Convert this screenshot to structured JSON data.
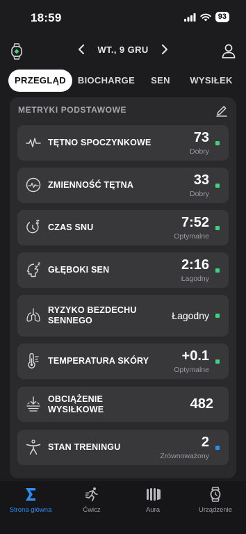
{
  "status_bar": {
    "time": "18:59",
    "battery": "93"
  },
  "header": {
    "date_label": "WT., 9 GRU"
  },
  "tabs": [
    {
      "label": "PRZEGLĄD",
      "active": true
    },
    {
      "label": "BIOCHARGE",
      "active": false
    },
    {
      "label": "SEN",
      "active": false
    },
    {
      "label": "WYSIŁEK",
      "active": false
    }
  ],
  "section": {
    "title": "METRYKI PODSTAWOWE"
  },
  "metrics": [
    {
      "label": "TĘTNO SPOCZYNKOWE",
      "value": "73",
      "sub": "Dobry",
      "status_color": "#3dd37a",
      "icon": "heart-rate-icon"
    },
    {
      "label": "ZMIENNOŚĆ TĘTNA",
      "value": "33",
      "sub": "Dobry",
      "status_color": "#3dd37a",
      "icon": "hrv-icon"
    },
    {
      "label": "CZAS SNU",
      "value": "7:52",
      "sub": "Optymalne",
      "status_color": "#3dd37a",
      "icon": "sleep-time-icon"
    },
    {
      "label": "GŁĘBOKI SEN",
      "value": "2:16",
      "sub": "Łagodny",
      "status_color": "#3dd37a",
      "icon": "deep-sleep-icon"
    },
    {
      "label": "RYZYKO BEZDECHU SENNEGO",
      "value": "Łagodny",
      "sub": "",
      "status_color": "#3dd37a",
      "icon": "lungs-icon"
    },
    {
      "label": "TEMPERATURA SKÓRY",
      "value": "+0.1",
      "sub": "Optymalne",
      "status_color": "#3dd37a",
      "icon": "thermometer-icon"
    },
    {
      "label": "OBCIĄŻENIE WYSIŁKOWE",
      "value": "482",
      "sub": "",
      "status_color": "",
      "icon": "strain-icon"
    },
    {
      "label": "STAN TRENINGU",
      "value": "2",
      "sub": "Zrównoważony",
      "status_color": "#2f8cf0",
      "icon": "training-state-icon"
    }
  ],
  "bottom_nav": [
    {
      "label": "Strona główna",
      "active": true,
      "icon": "sigma-home-icon"
    },
    {
      "label": "Ćwicz",
      "active": false,
      "icon": "running-icon"
    },
    {
      "label": "Aura",
      "active": false,
      "icon": "aura-icon"
    },
    {
      "label": "Urządzenie",
      "active": false,
      "icon": "watch-icon"
    }
  ],
  "colors": {
    "accent": "#2f8cf0",
    "good": "#3dd37a",
    "background": "#1c1c1e",
    "card": "#2a2a2c",
    "tile": "#38383b"
  }
}
